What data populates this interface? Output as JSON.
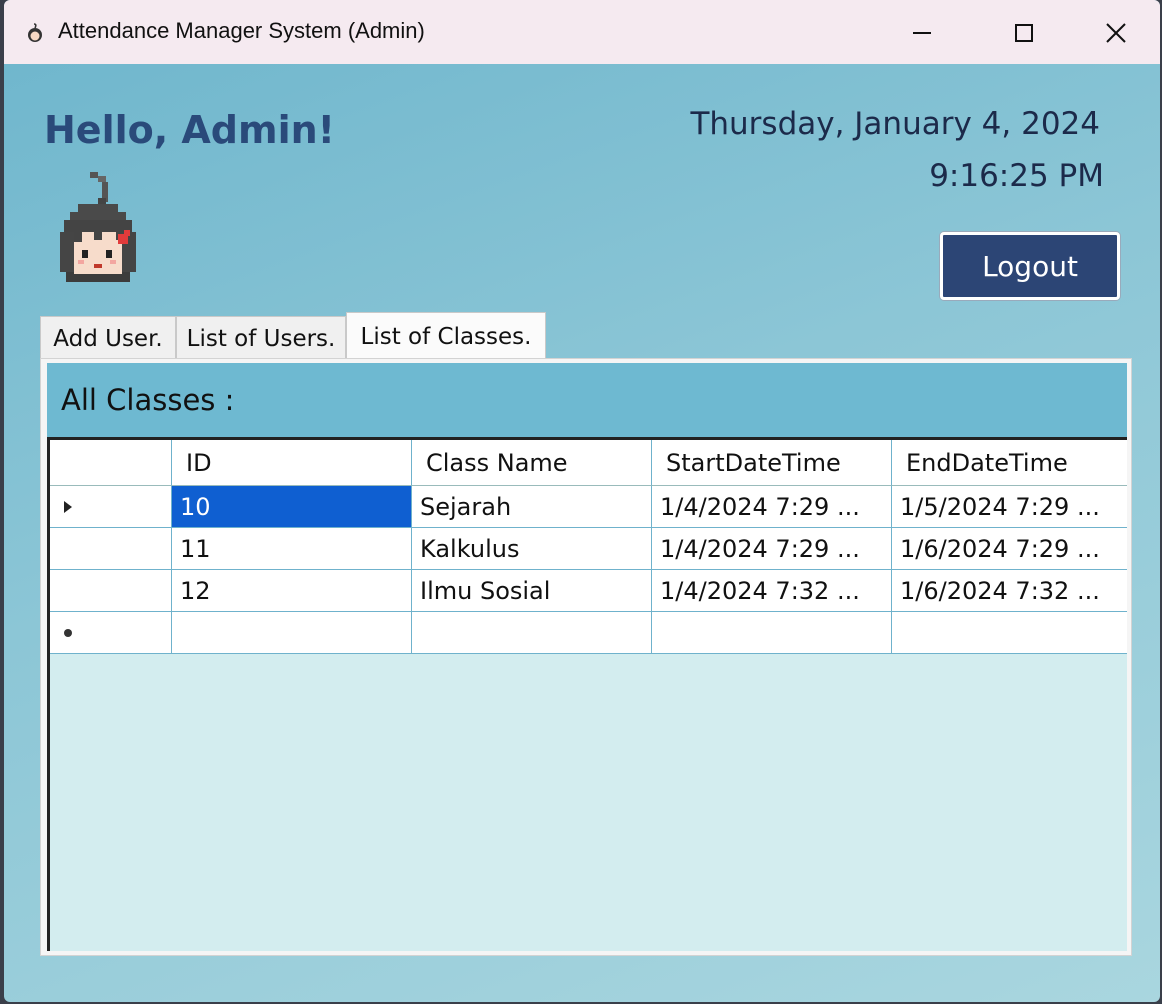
{
  "window": {
    "title": "Attendance Manager System (Admin)"
  },
  "header": {
    "greeting": "Hello, Admin!",
    "date": "Thursday, January 4, 2024",
    "time": "9:16:25 PM",
    "logout_label": "Logout"
  },
  "tabs": [
    {
      "label": "Add User."
    },
    {
      "label": "List of Users."
    },
    {
      "label": "List of Classes.",
      "active": true
    }
  ],
  "classes": {
    "heading": "All Classes :",
    "columns": [
      "ID",
      "Class Name",
      "StartDateTime",
      "EndDateTime"
    ],
    "rows": [
      {
        "id": "10",
        "name": "Sejarah",
        "start": "1/4/2024 7:29 ...",
        "end": "1/5/2024 7:29 ..."
      },
      {
        "id": "11",
        "name": "Kalkulus",
        "start": "1/4/2024 7:29 ...",
        "end": "1/6/2024 7:29 ..."
      },
      {
        "id": "12",
        "name": "Ilmu Sosial",
        "start": "1/4/2024 7:32 ...",
        "end": "1/6/2024 7:32 ..."
      }
    ]
  },
  "colors": {
    "accent": "#2c4575",
    "header_band": "#6eb9d1",
    "selection": "#0f5fd1"
  }
}
